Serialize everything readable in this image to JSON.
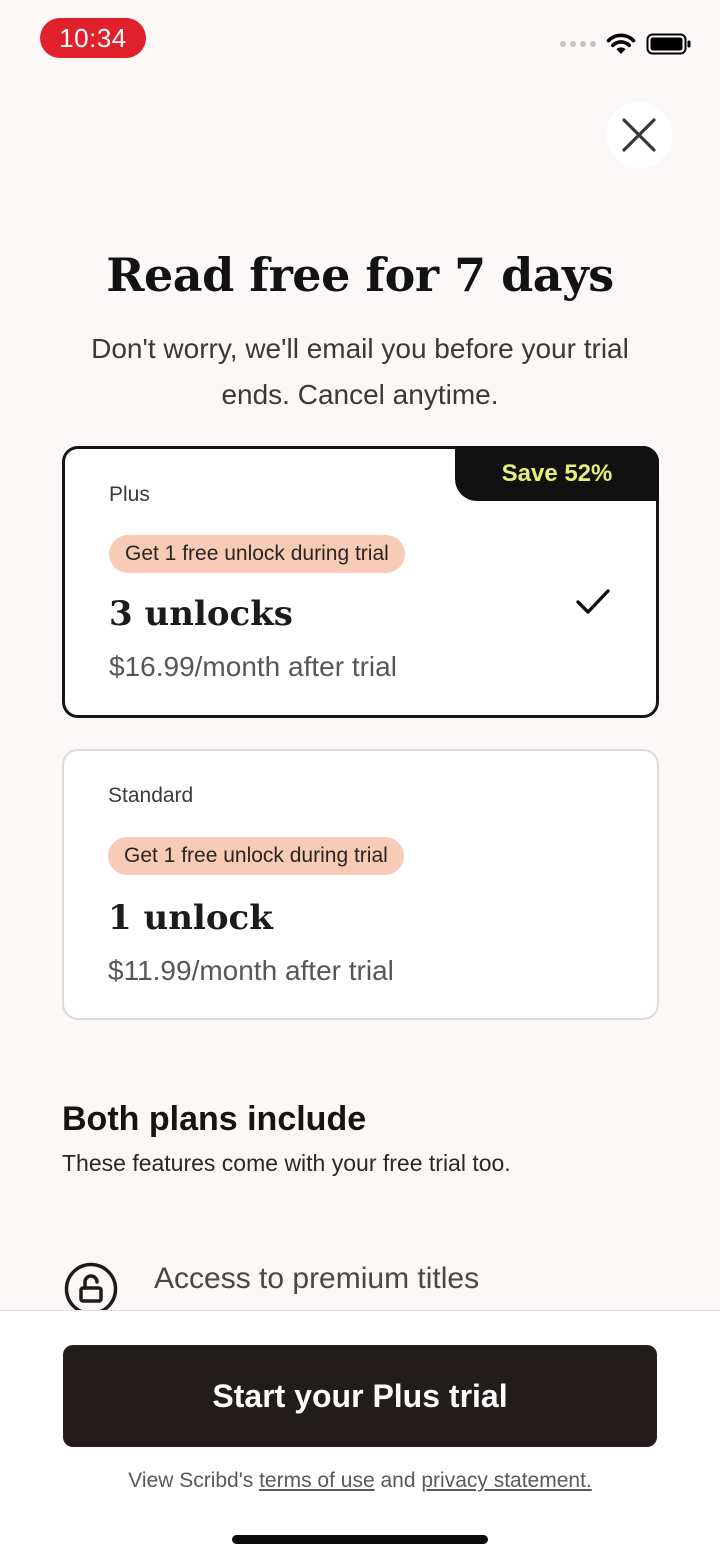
{
  "status_bar": {
    "time": "10:34"
  },
  "header": {
    "title": "Read free for 7 days",
    "subtitle": "Don't worry, we'll email you before your trial ends. Cancel anytime."
  },
  "plans": [
    {
      "badge": "Save 52%",
      "name": "Plus",
      "trial_note": "Get 1 free unlock during trial",
      "unlocks": "3 unlocks",
      "price": "$16.99/month after trial",
      "selected": true
    },
    {
      "name": "Standard",
      "trial_note": "Get 1 free unlock during trial",
      "unlocks": "1 unlock",
      "price": "$11.99/month after trial",
      "selected": false
    }
  ],
  "features": {
    "title": "Both plans include",
    "subtitle": "These features come with your free trial too.",
    "items": [
      {
        "icon": "unlock-icon",
        "label": "Access to premium titles"
      }
    ]
  },
  "footer": {
    "cta_label": "Start your Plus trial",
    "legal_prefix": "View Scribd's",
    "terms_link": "terms of use",
    "legal_and": "and",
    "privacy_link": "privacy statement."
  },
  "colors": {
    "status_time_bg": "#e0202b",
    "badge_text": "#e3f07a",
    "trial_pill_bg": "#f7cbb5",
    "cta_bg": "#221d1a"
  }
}
